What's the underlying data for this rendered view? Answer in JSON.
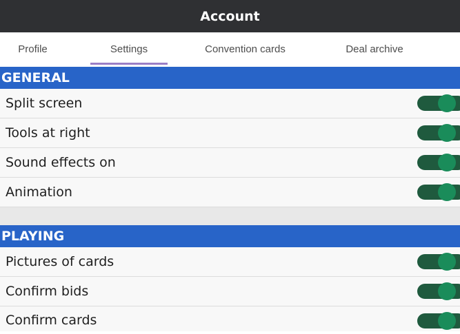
{
  "window": {
    "title": "Account"
  },
  "tabs": [
    {
      "label": "Profile",
      "active": false
    },
    {
      "label": "Settings",
      "active": true
    },
    {
      "label": "Convention cards",
      "active": false
    },
    {
      "label": "Deal archive",
      "active": false
    }
  ],
  "sections": [
    {
      "title": "GENERAL",
      "items": [
        {
          "label": "Split screen",
          "enabled": true
        },
        {
          "label": "Tools at right",
          "enabled": true
        },
        {
          "label": "Sound effects on",
          "enabled": true
        },
        {
          "label": "Animation",
          "enabled": true
        }
      ]
    },
    {
      "title": "PLAYING",
      "items": [
        {
          "label": "Pictures of cards",
          "enabled": true
        },
        {
          "label": "Confirm bids",
          "enabled": true
        },
        {
          "label": "Confirm cards",
          "enabled": true
        }
      ]
    }
  ],
  "colors": {
    "titlebar_bg": "#2f3033",
    "section_header_bg": "#2864c8",
    "toggle_track": "#1f5a3e",
    "toggle_knob": "#1a8c5a",
    "tab_indicator": "#9b7fc6"
  }
}
